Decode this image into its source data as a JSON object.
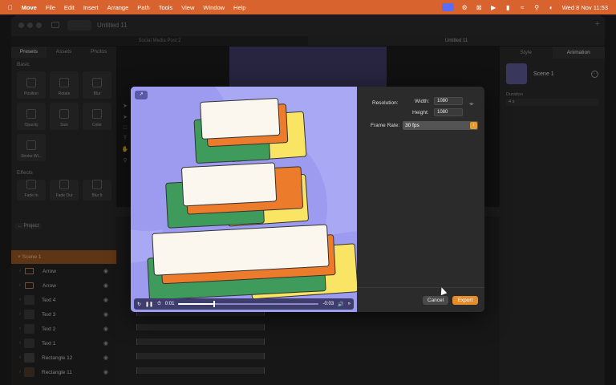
{
  "menubar": {
    "apple_icon": "apple-logo-icon",
    "app_name": "Move",
    "items": [
      "File",
      "Edit",
      "Insert",
      "Arrange",
      "Path",
      "Tools",
      "View",
      "Window",
      "Help"
    ],
    "clock": "Wed 8 Nov  11:53"
  },
  "window": {
    "title": "Untitled 11",
    "doc_tabs": [
      "Social Media Post 2",
      "Untitled 11"
    ]
  },
  "left_panel": {
    "tabs": [
      "Presets",
      "Assets",
      "Photos"
    ],
    "basic_heading": "Basic",
    "basic_presets": [
      "Position",
      "Rotate",
      "Blur",
      "Opacity",
      "Size",
      "Color",
      "Stroke Wi..."
    ],
    "effects_heading": "Effects",
    "effect_presets": [
      "Fade In",
      "Fade Out",
      "Blur It"
    ],
    "project_button": "Project"
  },
  "layers": {
    "scene": "Scene 1",
    "items": [
      "Arrow",
      "Arrow",
      "Text 4",
      "Text 3",
      "Text 2",
      "Text 1",
      "Rectangle 12",
      "Rectangle 11"
    ]
  },
  "right_panel": {
    "tabs": [
      "Style",
      "Animation"
    ],
    "scene_name": "Scene 1",
    "duration_label": "Duration",
    "duration_value": "4 s"
  },
  "export_dialog": {
    "resolution_label": "Resolution:",
    "width_label": "Width:",
    "width_value": "1080",
    "height_label": "Height:",
    "height_value": "1080",
    "frame_rate_label": "Frame Rate:",
    "frame_rate_value": "30 fps",
    "cancel_label": "Cancel",
    "export_label": "Export",
    "playback": {
      "current_time": "0:01",
      "remaining_time": "-0:03",
      "progress": 0.25
    }
  },
  "colors": {
    "menubar": "#d9632e",
    "accent_orange": "#e48d2a",
    "preview_bg": "#a9a8f5",
    "card_cream": "#fbf7ef",
    "card_orange": "#ec7b2c",
    "card_green": "#3f9b5b",
    "card_yellow": "#f9e464"
  }
}
